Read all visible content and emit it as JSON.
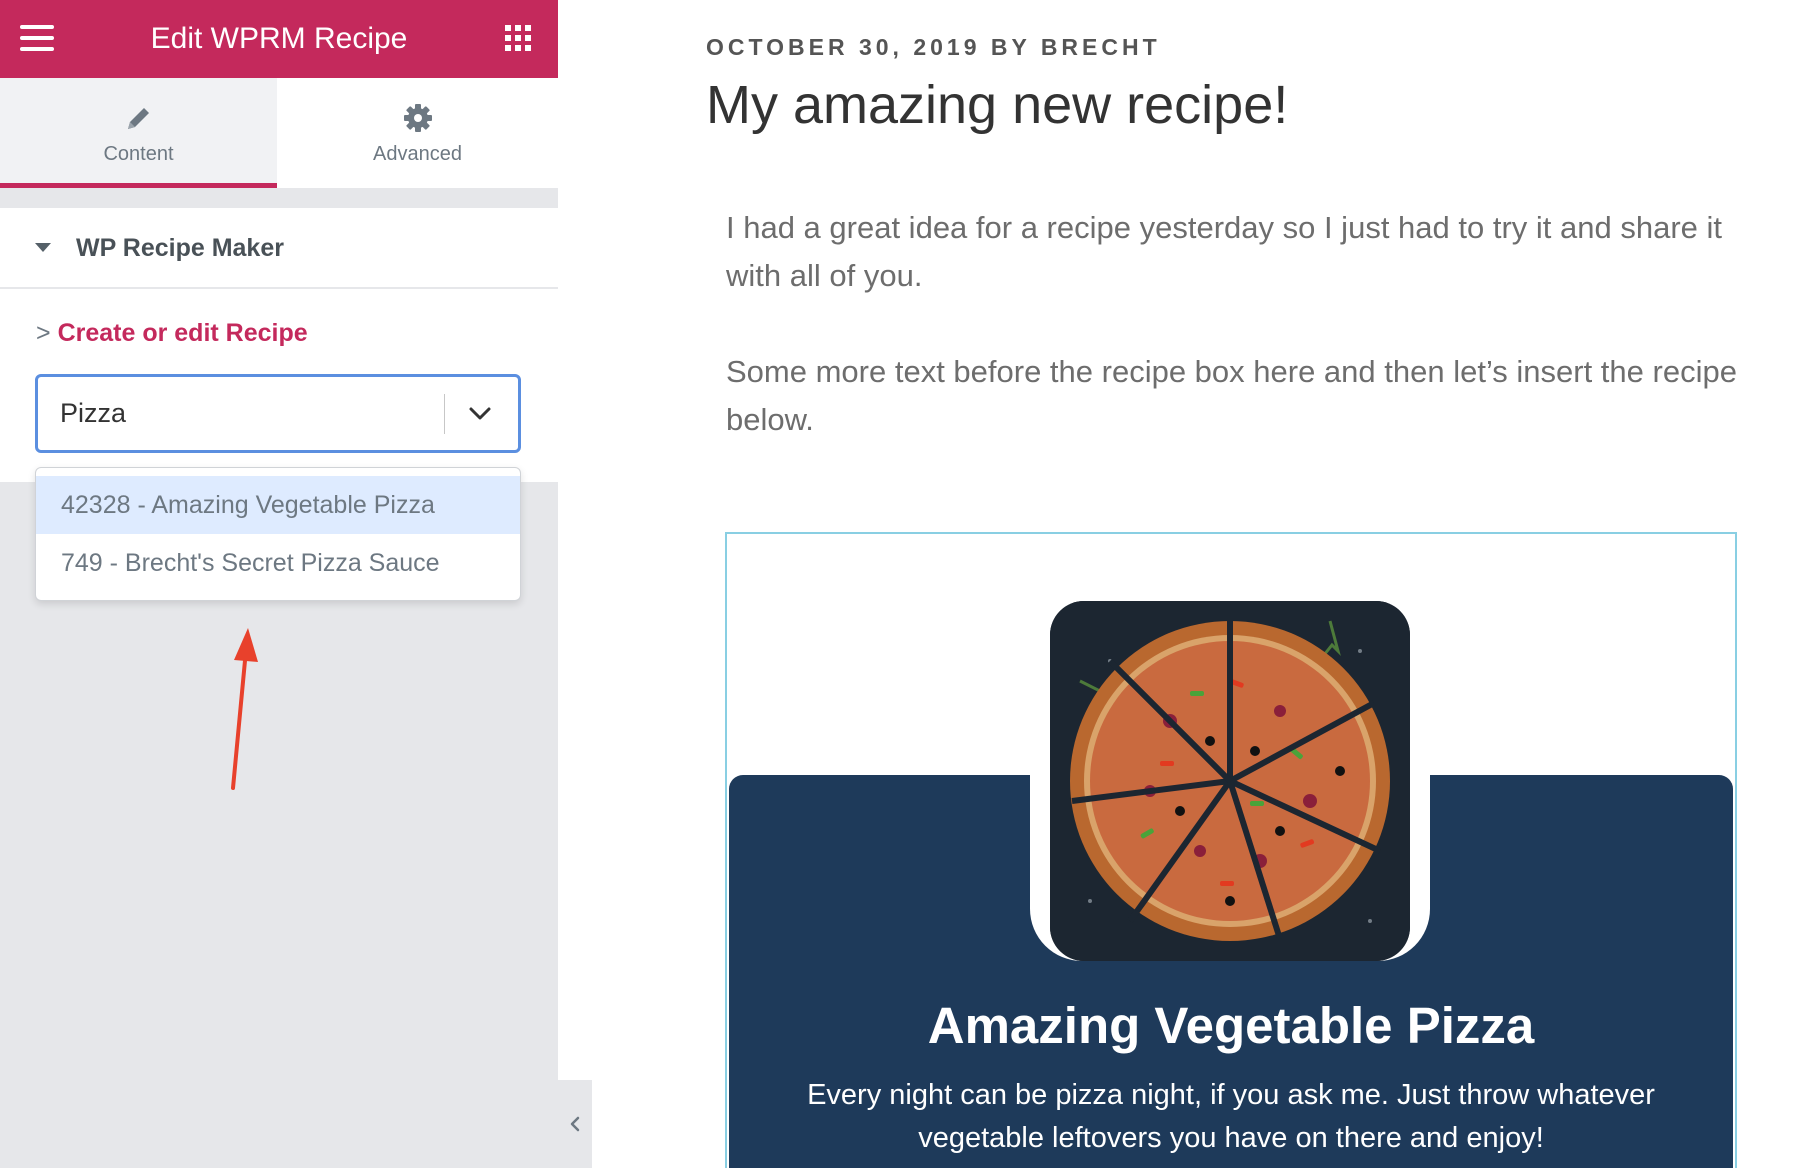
{
  "sidebar": {
    "header": {
      "title": "Edit WPRM Recipe"
    },
    "tabs": [
      {
        "label": "Content",
        "icon": "pencil-icon",
        "active": true
      },
      {
        "label": "Advanced",
        "icon": "gear-icon",
        "active": false
      }
    ],
    "section": {
      "title": "WP Recipe Maker"
    },
    "link": {
      "prefix": ">",
      "label": "Create or edit Recipe"
    },
    "select": {
      "value": "Pizza"
    },
    "dropdown": {
      "options": [
        {
          "label": "42328 - Amazing Vegetable Pizza",
          "highlighted": true
        },
        {
          "label": "749 - Brecht's Secret Pizza Sauce",
          "highlighted": false
        }
      ]
    }
  },
  "post": {
    "meta": "OCTOBER 30, 2019 BY BRECHT",
    "title": "My amazing new recipe!",
    "paragraphs": [
      "I had a great idea for a recipe yesterday so I just had to try it and share it with all of you.",
      "Some more text before the recipe box here and then let’s insert the recipe below."
    ]
  },
  "recipe": {
    "title": "Amazing Vegetable Pizza",
    "summary": "Every night can be pizza night, if you ask me. Just throw whatever vegetable leftovers you have on there and enjoy!"
  },
  "colors": {
    "brand": "#c4295c",
    "focus_border": "#5b8fe0",
    "recipe_background": "#1e3a5a",
    "annotation_arrow": "#e8412c"
  }
}
